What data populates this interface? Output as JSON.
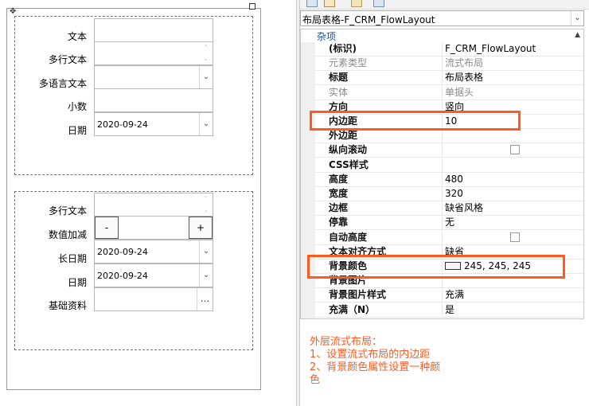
{
  "designer": {
    "group1": {
      "fields": [
        {
          "label": "文本",
          "value": "",
          "kind": "text"
        },
        {
          "label": "多行文本",
          "value": "",
          "kind": "multiline"
        },
        {
          "label": "多语言文本",
          "value": "",
          "kind": "dropdown"
        },
        {
          "label": "小数",
          "value": "",
          "kind": "text"
        },
        {
          "label": "日期",
          "value": "2020-09-24",
          "kind": "dropdown"
        }
      ]
    },
    "group2": {
      "fields": [
        {
          "label": "多行文本",
          "value": "",
          "kind": "multiline"
        },
        {
          "label": "数值加减",
          "value": "",
          "kind": "stepper",
          "minus": "-",
          "plus": "+"
        },
        {
          "label": "长日期",
          "value": "2020-09-24",
          "kind": "dropdown"
        },
        {
          "label": "日期",
          "value": "2020-09-24",
          "kind": "dropdown"
        },
        {
          "label": "基础资料",
          "value": "",
          "kind": "browse",
          "browse_label": "..."
        }
      ]
    }
  },
  "props": {
    "selector": "布局表格-F_CRM_FlowLayout",
    "category": "杂项",
    "rows": [
      {
        "name": "(标识)",
        "value": "F_CRM_FlowLayout",
        "bold": true
      },
      {
        "name": "元素类型",
        "value": "流式布局",
        "dim": true
      },
      {
        "name": "标题",
        "value": "布局表格",
        "bold": true
      },
      {
        "name": "实体",
        "value": "单据头",
        "dim": true
      },
      {
        "name": "方向",
        "value": "竖向",
        "bold": true
      },
      {
        "name": "内边距",
        "value": "10",
        "bold": true
      },
      {
        "name": "外边距",
        "value": "",
        "bold": true
      },
      {
        "name": "纵向滚动",
        "value": "",
        "bold": true,
        "checkbox": true
      },
      {
        "name": "CSS样式",
        "value": "",
        "bold": true
      },
      {
        "name": "高度",
        "value": "480",
        "bold": true
      },
      {
        "name": "宽度",
        "value": "320",
        "bold": true
      },
      {
        "name": "边框",
        "value": "缺省风格",
        "bold": true
      },
      {
        "name": "停靠",
        "value": "无",
        "bold": true
      },
      {
        "name": "自动高度",
        "value": "",
        "bold": true,
        "checkbox": true
      },
      {
        "name": "文本对齐方式",
        "value": "缺省",
        "bold": true
      },
      {
        "name": "背景颜色",
        "value": "245, 245, 245",
        "bold": true,
        "swatch": "#f5f5f5"
      },
      {
        "name": "背景图片",
        "value": "",
        "bold": true
      },
      {
        "name": "背景图片样式",
        "value": "充满",
        "bold": true
      },
      {
        "name": "充满（N）",
        "value": "是",
        "bold": true
      }
    ],
    "description": [
      "外层流式布局：",
      "1、设置流式布局的内边距",
      "2、背景颜色属性设置一种颜",
      "色"
    ]
  },
  "colors": {
    "annotation": "#ff5a1f",
    "category_text": "#1e50a8"
  }
}
